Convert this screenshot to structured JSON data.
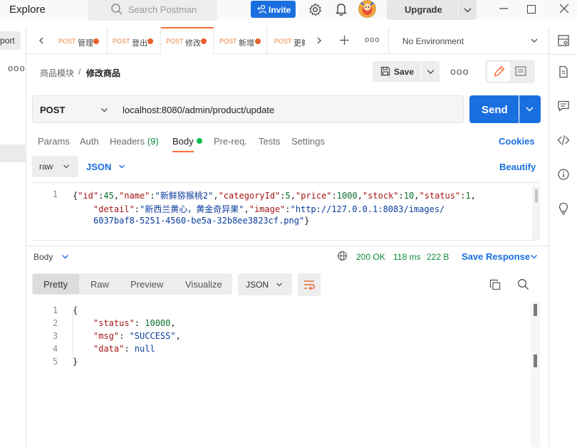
{
  "titlebar": {
    "explore": "Explore",
    "search_placeholder": "Search Postman",
    "invite": "Invite",
    "upgrade": "Upgrade"
  },
  "left": {
    "port_label": "port",
    "dots": "ooo"
  },
  "tabs": [
    {
      "method": "POST",
      "name": "管理"
    },
    {
      "method": "POST",
      "name": "登出"
    },
    {
      "method": "POST",
      "name": "修改"
    },
    {
      "method": "POST",
      "name": "新增"
    },
    {
      "method": "POST",
      "name": "更新"
    }
  ],
  "tabbar": {
    "more": "ooo",
    "environment": "No Environment"
  },
  "breadcrumb": {
    "parent": "商品模块",
    "separator": "/",
    "current": "修改商品"
  },
  "toolbar": {
    "save": "Save",
    "more": "ooo"
  },
  "request": {
    "method": "POST",
    "url": "localhost:8080/admin/product/update",
    "send": "Send"
  },
  "request_tabs": {
    "params": "Params",
    "auth": "Auth",
    "headers": "Headers",
    "headers_count": "(9)",
    "body": "Body",
    "prereq": "Pre-req.",
    "tests": "Tests",
    "settings": "Settings",
    "cookies": "Cookies"
  },
  "body_options": {
    "mode": "raw",
    "language": "JSON",
    "beautify": "Beautify"
  },
  "request_body": {
    "line_number": "1",
    "line1": {
      "k_id": "\"id\"",
      "v_id": "45",
      "k_name": "\"name\"",
      "v_name": "\"新鲜猕猴桃2\"",
      "k_cat": "\"categoryId\"",
      "v_cat": "5",
      "k_price": "\"price\"",
      "v_price": "1000",
      "k_stock": "\"stock\"",
      "v_stock": "10",
      "k_status": "\"status\"",
      "v_status": "1"
    },
    "line2": {
      "k_detail": "\"detail\"",
      "v_detail": "\"新西兰黄心，黄金奇异果\"",
      "k_image": "\"image\"",
      "v_image_a": "\"http://127.0.0.1:8083/images/"
    },
    "line3": {
      "v_image_b": "6037baf8-5251-4560-be5a-32b8ee3823cf.png\""
    }
  },
  "response_header": {
    "body_label": "Body",
    "status": "200 OK",
    "time": "118 ms",
    "size": "222 B",
    "save_response": "Save Response"
  },
  "response_views": {
    "pretty": "Pretty",
    "raw": "Raw",
    "preview": "Preview",
    "visualize": "Visualize",
    "format": "JSON"
  },
  "response_body": {
    "line_numbers": [
      "1",
      "2",
      "3",
      "4",
      "5"
    ],
    "open": "{",
    "k_status": "\"status\"",
    "v_status": "10000",
    "k_msg": "\"msg\"",
    "v_msg": "\"SUCCESS\"",
    "k_data": "\"data\"",
    "v_data": "null",
    "close": "}"
  },
  "colors": {
    "accent": "#1a6fe0",
    "brand_orange": "#ff6c37",
    "success": "#0a8a3b"
  }
}
